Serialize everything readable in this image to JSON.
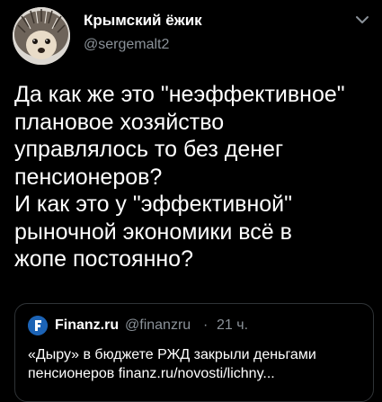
{
  "tweet": {
    "author": {
      "name": "Крымский ёжик",
      "handle": "@sergemalt2",
      "avatar_icon": "hedgehog-avatar"
    },
    "menu_icon": "chevron-down-icon",
    "text_lines": [
      "Да как же это \"неэффективное\"",
      "плановое хозяйство",
      "управлялось то без денег",
      "пенсионеров?",
      "И как это у \"эффективной\"",
      "рыночной экономики всё в",
      "жопе постоянно?"
    ]
  },
  "quote": {
    "author": {
      "name": "Finanz.ru",
      "handle": "@finanzru",
      "separator": "·",
      "time": "21 ч.",
      "avatar_icon": "finanz-logo"
    },
    "text_lines": [
      "«Дыру» в бюджете РЖД закрыли деньгами",
      "пенсионеров  finanz.ru/novosti/lichny..."
    ]
  },
  "colors": {
    "background": "#000000",
    "text_primary": "#ffffff",
    "text_secondary": "#8b9299",
    "border": "#2f3336",
    "finanz_blue": "#1c63b5"
  }
}
